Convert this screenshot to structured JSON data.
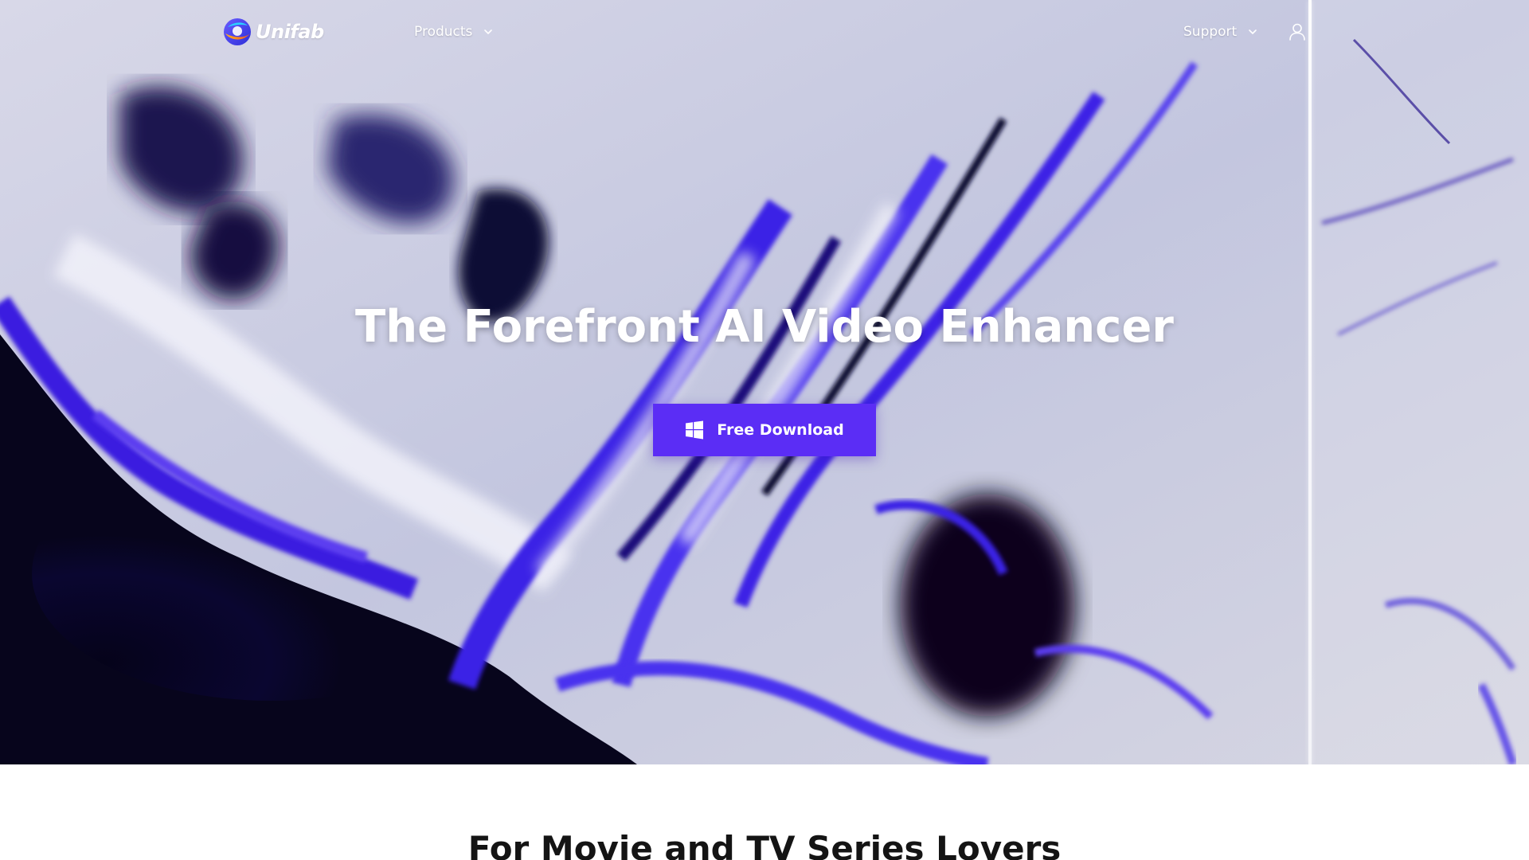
{
  "brand": {
    "name": "Unifab",
    "accent": "#5b2df5"
  },
  "nav": {
    "products_label": "Products",
    "support_label": "Support",
    "user_icon": "user-icon"
  },
  "hero": {
    "title": "The Forefront AI Video Enhancer",
    "download_label": "Free Download",
    "download_icon": "windows-icon"
  },
  "section": {
    "heading": "For Movie and TV Series Lovers"
  }
}
